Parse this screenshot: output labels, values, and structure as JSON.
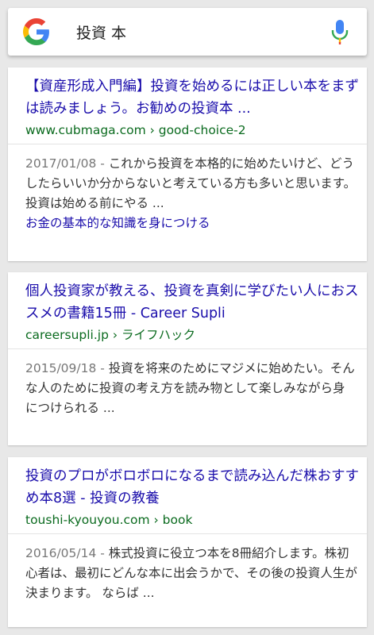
{
  "search": {
    "query": "投資 本"
  },
  "icons": {
    "logo": "google-g-logo",
    "mic": "microphone-icon"
  },
  "results": [
    {
      "title": "【資産形成入門編】投資を始めるには正しい本をまずは読みましょう。お勧めの投資本 ...",
      "url": "www.cubmaga.com › good-choice-2",
      "date": "2017/01/08 -",
      "snippet": "これから投資を本格的に始めたいけど、どうしたらいいか分からないと考えている方も多いと思います。 投資は始める前にやる ...",
      "link": "お金の基本的な知識を身につける"
    },
    {
      "title": "個人投資家が教える、投資を真剣に学びたい人におススメの書籍15冊 - Career Supli",
      "url": "careersupli.jp › ライフハック",
      "date": "2015/09/18 -",
      "snippet": "投資を将来のためにマジメに始めたい。そんな人のために投資の考え方を読み物として楽しみながら身につけられる ..."
    },
    {
      "title": "投資のプロがボロボロになるまで読み込んだ株おすすめ本8選 - 投資の教養",
      "url": "toushi-kyouyou.com › book",
      "date": "2016/05/14 -",
      "snippet": "株式投資に役立つ本を8冊紹介します。株初心者は、最初にどんな本に出会うかで、その後の投資人生が決まります。 ならば ..."
    }
  ]
}
